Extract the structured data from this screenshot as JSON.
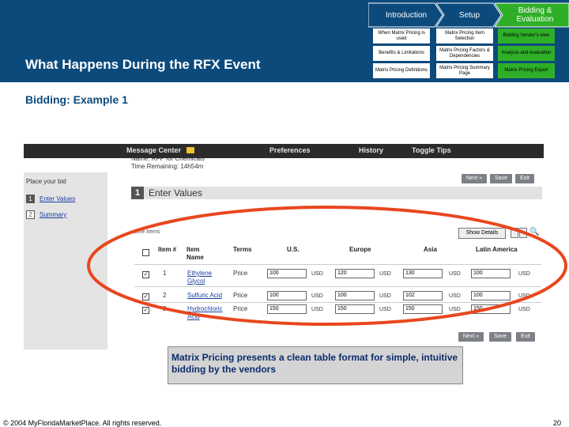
{
  "colors": {
    "banner": "#0c4a7c",
    "nav_active": "#2fae28",
    "highlight_ellipse": "#e8471e"
  },
  "nav": {
    "tabs": [
      {
        "label": "Introduction"
      },
      {
        "label": "Setup"
      },
      {
        "label": "Bidding & Evaluation"
      }
    ],
    "sub_items": [
      "When Matrix Pricing is used",
      "Matrix Pricing Item Selection",
      "Bidding Vendor's view",
      "Benefits & Limitations",
      "Matrix Pricing Factors & Dependencies",
      "Analysis and evaluation",
      "Matrix Pricing Definitions",
      "Matrix Pricing Summary Page",
      "Matrix Pricing Export"
    ]
  },
  "slide": {
    "title": "What Happens During the RFX Event",
    "subtitle": "Bidding: Example 1",
    "callout": "Matrix Pricing presents a clean table format for simple, intuitive bidding by the vendors",
    "footer": "© 2004 MyFloridaMarketPlace. All rights reserved.",
    "page_number": "20"
  },
  "screenshot": {
    "topnav": [
      "Message Center",
      "Preferences",
      "History",
      "Toggle Tips"
    ],
    "left_title": "Place your bid",
    "steps": [
      {
        "num": "1",
        "label": "Enter Values"
      },
      {
        "num": "2",
        "label": "Summary"
      }
    ],
    "rfx_name": "Name: RFP for Chemicals",
    "time_remaining": "Time Remaining: 14h54m",
    "buttons": {
      "next": "Next »",
      "save": "Save",
      "exit": "Exit"
    },
    "section_num": "1",
    "section_title": "Enter Values",
    "line_items_label": "Line Items",
    "show_details": "Show Details",
    "columns": [
      "Item #",
      "Item Name",
      "Terms",
      "U.S.",
      "Europe",
      "Asia",
      "Latin America"
    ],
    "rows": [
      {
        "num": "1",
        "name": "Ethylene Glycol",
        "terms": "Price",
        "us": "100",
        "eu": "120",
        "asia": "130",
        "latam": "100"
      },
      {
        "num": "2",
        "name": "Sulfuric Acid",
        "terms": "Price",
        "us": "100",
        "eu": "100",
        "asia": "102",
        "latam": "100"
      },
      {
        "num": "3",
        "name": "Hydrochloric Acid",
        "terms": "Price",
        "us": "150",
        "eu": "150",
        "asia": "150",
        "latam": "150"
      }
    ],
    "currency": "USD"
  }
}
